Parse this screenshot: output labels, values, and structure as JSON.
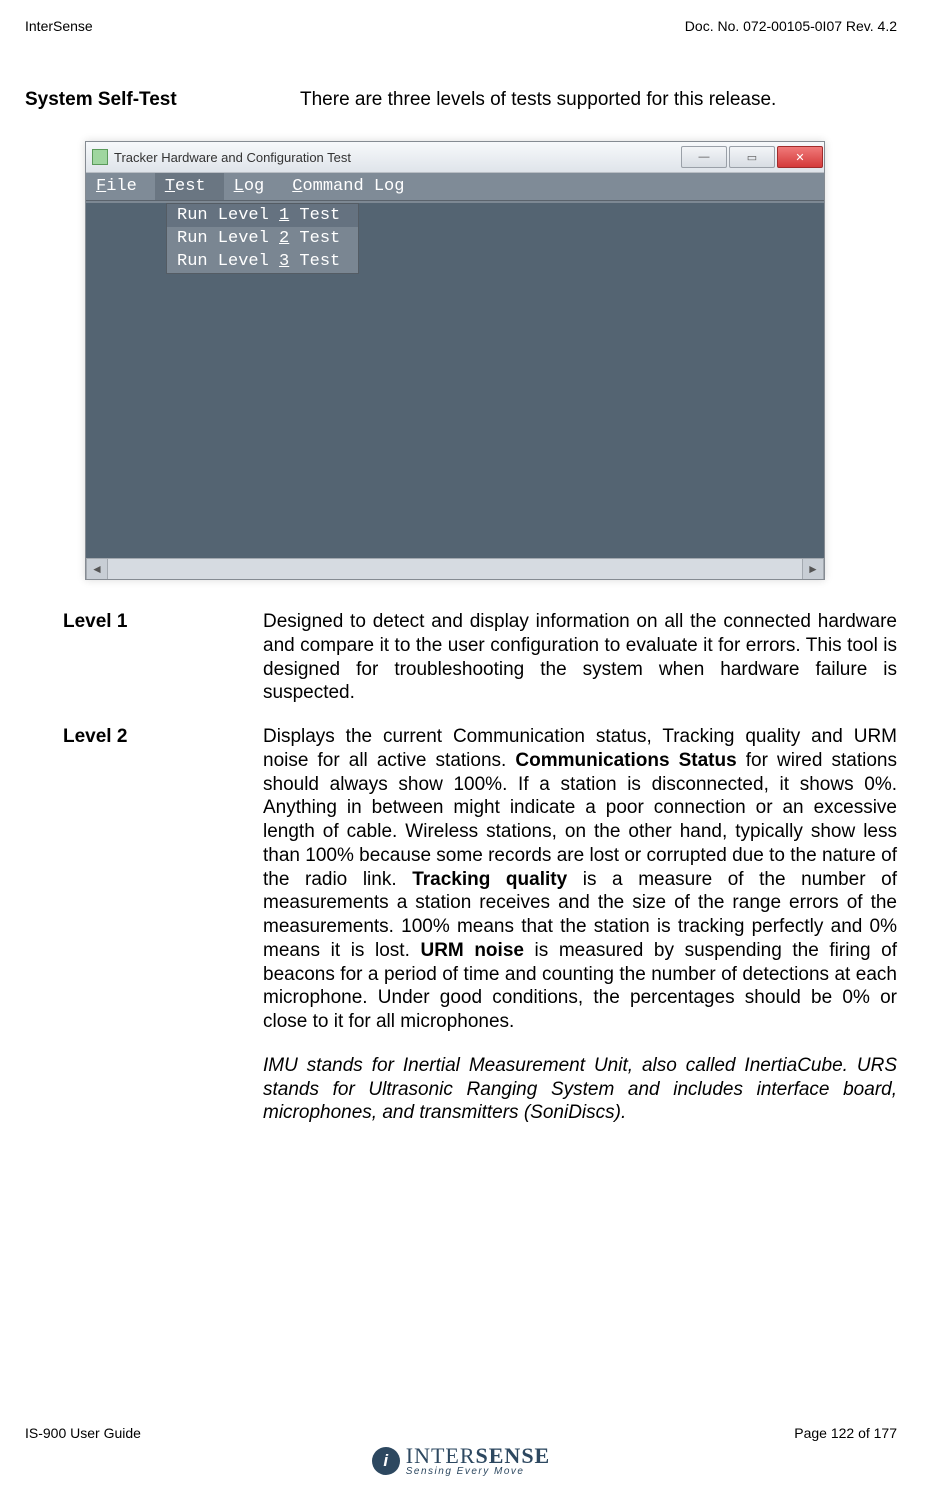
{
  "header": {
    "left": "InterSense",
    "right": "Doc. No. 072-00105-0I07 Rev. 4.2"
  },
  "heading": {
    "title": "System Self-Test",
    "text": "There are three levels of tests supported for this release."
  },
  "window": {
    "title": "Tracker Hardware and Configuration Test",
    "menu": {
      "file": "File",
      "test": "Test",
      "log": "Log",
      "cmdlog": "Command Log"
    },
    "dropdown": {
      "item1": "Run Level 1 Test",
      "item2": "Run Level 2 Test",
      "item3": "Run Level 3 Test"
    },
    "minimize": "—",
    "maximize": "▭",
    "close": "✕",
    "scroll_left": "◄",
    "scroll_right": "►"
  },
  "defs": {
    "level1": {
      "term": "Level 1",
      "text": "Designed to detect and display information on all the connected hardware and compare it to the user configuration to evaluate it for errors.  This tool is designed for troubleshooting the system when hardware failure is suspected."
    },
    "level2": {
      "term": "Level 2",
      "text_a": "Displays the current Communication status, Tracking quality and URM noise for all active stations.  ",
      "b1": "Communications Status",
      "text_b": " for wired stations should always show 100%.  If a station is disconnected, it shows 0%.  Anything in between might indicate a poor connection or an excessive length of cable.  Wireless stations, on the other hand, typically show less than 100% because some records are lost or corrupted due to the nature of the radio link.  ",
      "b2": "Tracking quality",
      "text_c": " is a measure of the number of measurements a station receives and the size of the range errors of the measurements.  100% means that the station is tracking perfectly and 0% means it is lost.  ",
      "b3": "URM noise",
      "text_d": " is measured by suspending the firing of beacons for a period of time and counting the number of detections at each microphone.  Under good conditions, the percentages should be 0% or close to it for all microphones."
    },
    "italic": "IMU stands for Inertial Measurement Unit, also called InertiaCube.  URS stands for Ultrasonic Ranging System and includes interface board, microphones, and transmitters (SoniDiscs)."
  },
  "footer": {
    "left": "IS-900 User Guide",
    "right": "Page 122 of 177",
    "logo_i": "i",
    "logo_main_light": "INTER",
    "logo_main_heavy": "SENSE",
    "logo_sub": "Sensing Every Move"
  }
}
